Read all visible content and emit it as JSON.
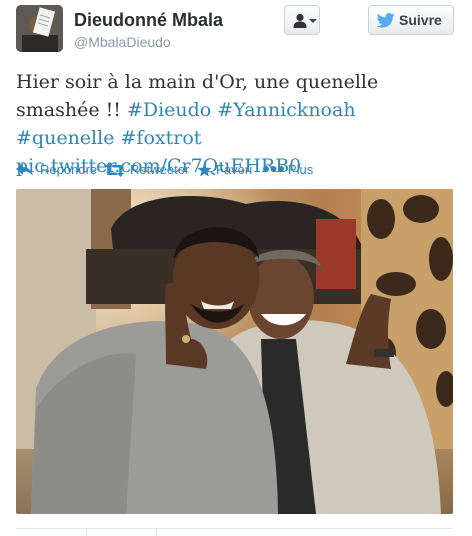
{
  "user": {
    "full_name": "Dieudonné Mbala",
    "screen_name": "@MbalaDieudo"
  },
  "buttons": {
    "user_menu_icon": "user-icon",
    "follow_label": "Suivre",
    "follow_icon": "twitter-bird-icon"
  },
  "tweet": {
    "text_plain": "Hier soir à la main d'Or, une quenelle smashée !!",
    "hashtags": [
      "#Dieudo",
      "#Yannicknoah",
      "#quenelle",
      "#foxtrot"
    ],
    "link": "pic.twitter.com/Cr7QuEHRB0"
  },
  "actions": [
    {
      "label": "Répondre",
      "icon": "reply-icon"
    },
    {
      "label": "Retweeter",
      "icon": "retweet-icon"
    },
    {
      "label": "Favori",
      "icon": "star-icon"
    },
    {
      "label": "Plus",
      "icon": "more-dots-icon"
    }
  ],
  "colors": {
    "link_blue": "#2f87b8",
    "name_dark": "#292f33",
    "muted_gray": "#8899a6"
  }
}
